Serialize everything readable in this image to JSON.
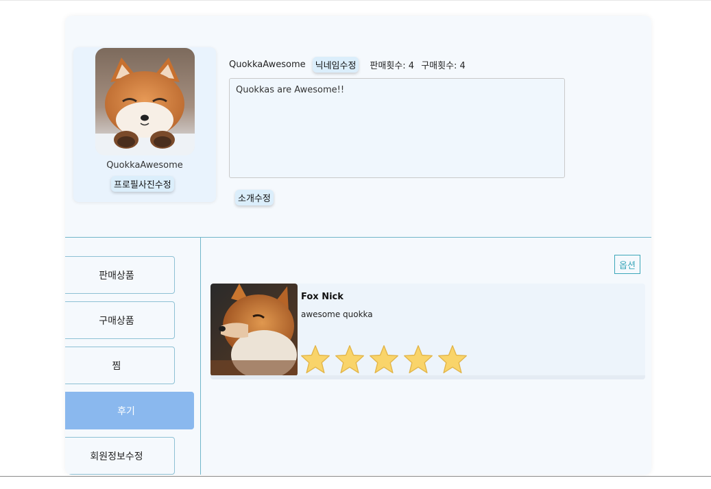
{
  "profile": {
    "name": "QuokkaAwesome",
    "photo_edit_label": "프로필사진수정",
    "nickname": "QuokkaAwesome",
    "nickname_edit_label": "닉네임수정",
    "sales_count_text": "판매횟수: 4",
    "purchase_count_text": "구매횟수: 4",
    "intro_text": "Quokkas are Awesome!!",
    "intro_edit_label": "소개수정"
  },
  "sidebar": {
    "items": [
      {
        "label": "판매상품",
        "active": false
      },
      {
        "label": "구매상품",
        "active": false
      },
      {
        "label": "찜",
        "active": false
      },
      {
        "label": "후기",
        "active": true
      },
      {
        "label": "회원정보수정",
        "active": false
      }
    ]
  },
  "reviews": {
    "options_label": "옵션",
    "items": [
      {
        "reviewer": "Fox Nick",
        "text": "awesome quokka",
        "rating": 5
      }
    ]
  },
  "colors": {
    "card_bg": "#f5f9fd",
    "accent_line": "#6fb5c9",
    "active_menu": "#8ab8ee",
    "options_border": "#3aa6b9",
    "star": "#f9d46a"
  },
  "icons": {
    "avatar": "fox-avatar-image",
    "review_photo": "fox-photo-image",
    "rating": "star-icon"
  }
}
